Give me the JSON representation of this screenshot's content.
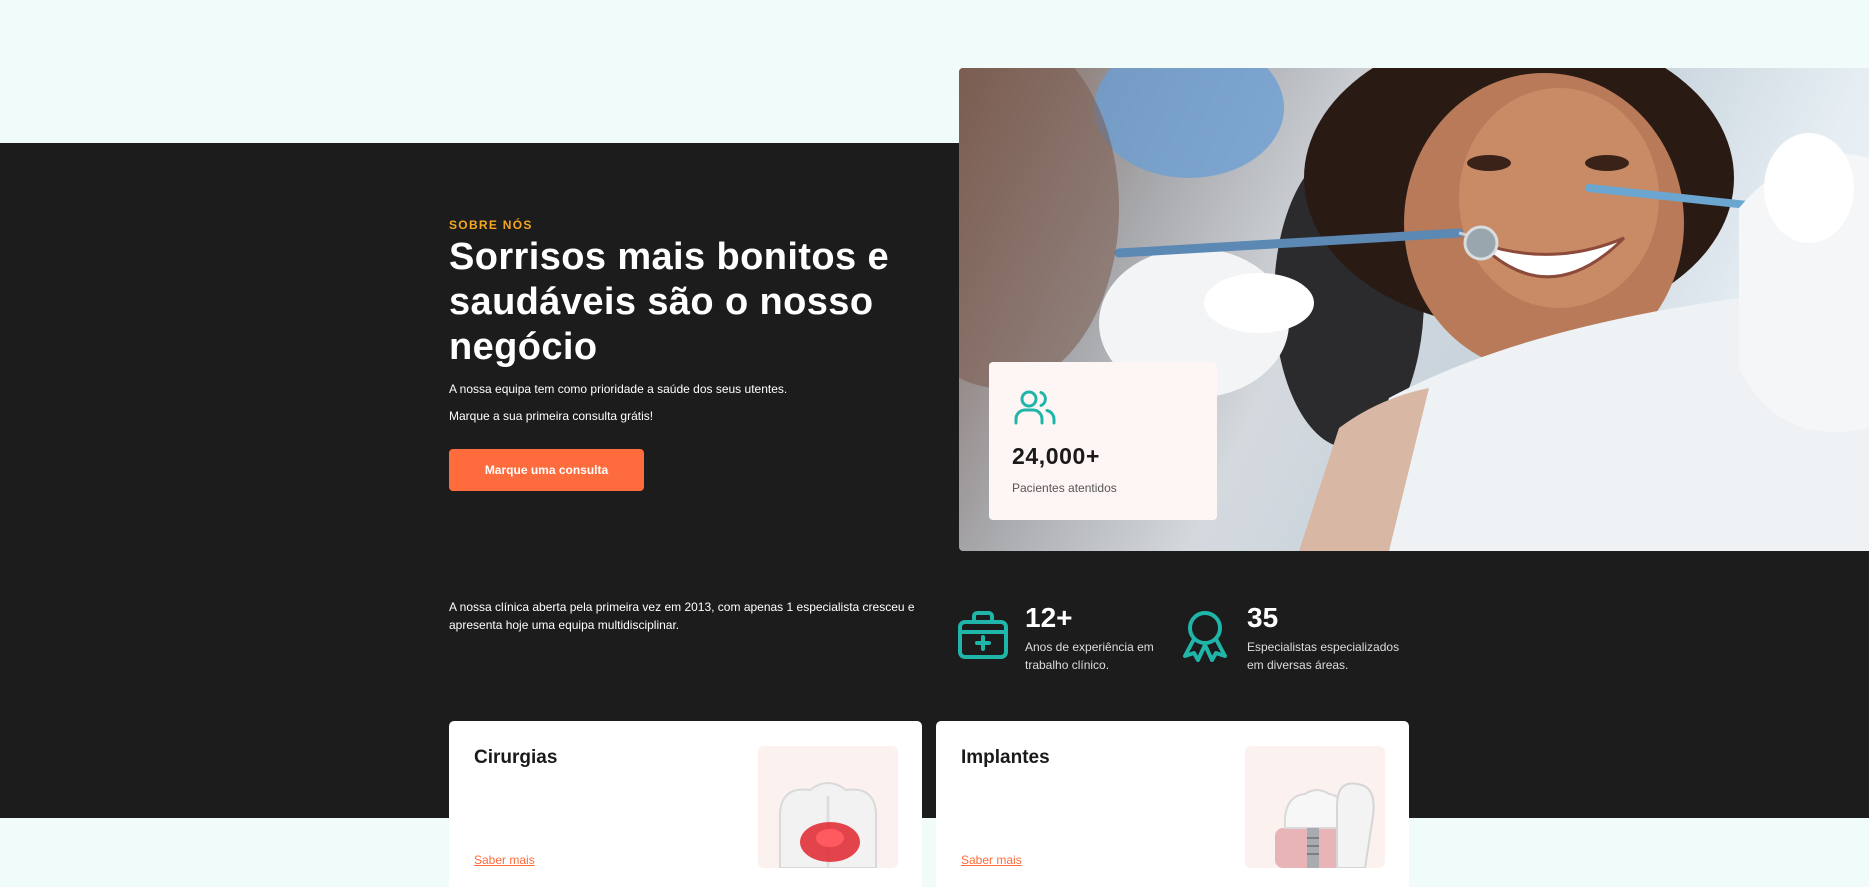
{
  "about": {
    "eyebrow": "SOBRE NÓS",
    "headline": "Sorrisos mais bonitos e saudáveis são o nosso negócio",
    "lead_1": "A nossa equipa tem como prioridade a saúde dos seus utentes.",
    "lead_2": "Marque a sua primeira consulta grátis!",
    "cta_label": "Marque uma consulta",
    "history": "A nossa clínica aberta pela primeira vez em 2013, com apenas 1 especialista cresceu e apresenta hoje uma equipa multidisciplinar."
  },
  "stat_card": {
    "icon": "users-icon",
    "value": "24,000+",
    "label": "Pacientes atentidos"
  },
  "facts": [
    {
      "icon": "medical-kit-icon",
      "value": "12+",
      "label": "Anos de experiência em trabalho clínico."
    },
    {
      "icon": "award-icon",
      "value": "35",
      "label": "Especialistas especializados em diversas áreas."
    }
  ],
  "services": [
    {
      "title": "Cirurgias",
      "link_label": "Saber mais"
    },
    {
      "title": "Implantes",
      "link_label": "Saber mais"
    }
  ],
  "colors": {
    "accent_orange": "#fe6b3c",
    "eyebrow_gold": "#f5a623",
    "teal": "#1fb5a8",
    "dark_band": "#1c1c1c",
    "page_bg": "#f1fbf9"
  }
}
